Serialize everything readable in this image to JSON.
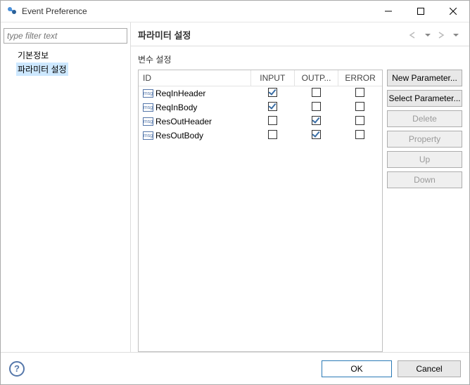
{
  "window": {
    "title": "Event Preference"
  },
  "filter": {
    "placeholder": "type filter text"
  },
  "tree": {
    "items": [
      "기본정보",
      "파라미터 설정"
    ],
    "selected_index": 1
  },
  "heading": "파라미터 설정",
  "section_title": "변수 설정",
  "columns": {
    "id": "ID",
    "input": "INPUT",
    "output": "OUTP...",
    "error": "ERROR"
  },
  "rows": [
    {
      "id": "ReqInHeader",
      "input": true,
      "output": false,
      "error": false
    },
    {
      "id": "ReqInBody",
      "input": true,
      "output": false,
      "error": false
    },
    {
      "id": "ResOutHeader",
      "input": false,
      "output": true,
      "error": false
    },
    {
      "id": "ResOutBody",
      "input": false,
      "output": true,
      "error": false
    }
  ],
  "buttons": {
    "new_parameter": "New Parameter...",
    "select_parameter": "Select Parameter...",
    "delete": "Delete",
    "property": "Property",
    "up": "Up",
    "down": "Down"
  },
  "footer": {
    "ok": "OK",
    "cancel": "Cancel"
  },
  "icons": {
    "msg": "msg"
  }
}
